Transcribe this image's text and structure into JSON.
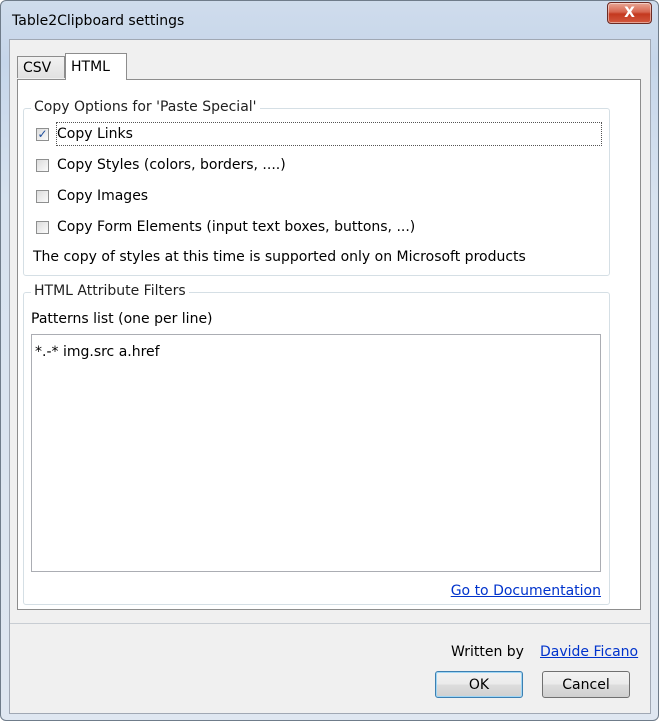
{
  "window": {
    "title": "Table2Clipboard settings",
    "close_label": "X"
  },
  "tabs": [
    {
      "label": "CSV"
    },
    {
      "label": "HTML"
    }
  ],
  "copy_options": {
    "legend": "Copy Options for 'Paste Special'",
    "options": [
      {
        "label": "Copy Links",
        "checked": true
      },
      {
        "label": "Copy Styles (colors, borders, ....)",
        "checked": false
      },
      {
        "label": "Copy Images",
        "checked": false
      },
      {
        "label": "Copy Form Elements (input text boxes, buttons, ...)",
        "checked": false
      }
    ],
    "note": "The copy of styles at this time is supported only on Microsoft products"
  },
  "filters": {
    "legend": "HTML Attribute Filters",
    "patterns_label": "Patterns list (one per line)",
    "patterns_value": "*.-* img.src a.href",
    "doc_link": "Go to Documentation"
  },
  "footer": {
    "written_by": "Written by",
    "author": "Davide Ficano",
    "ok_label": "OK",
    "cancel_label": "Cancel"
  }
}
